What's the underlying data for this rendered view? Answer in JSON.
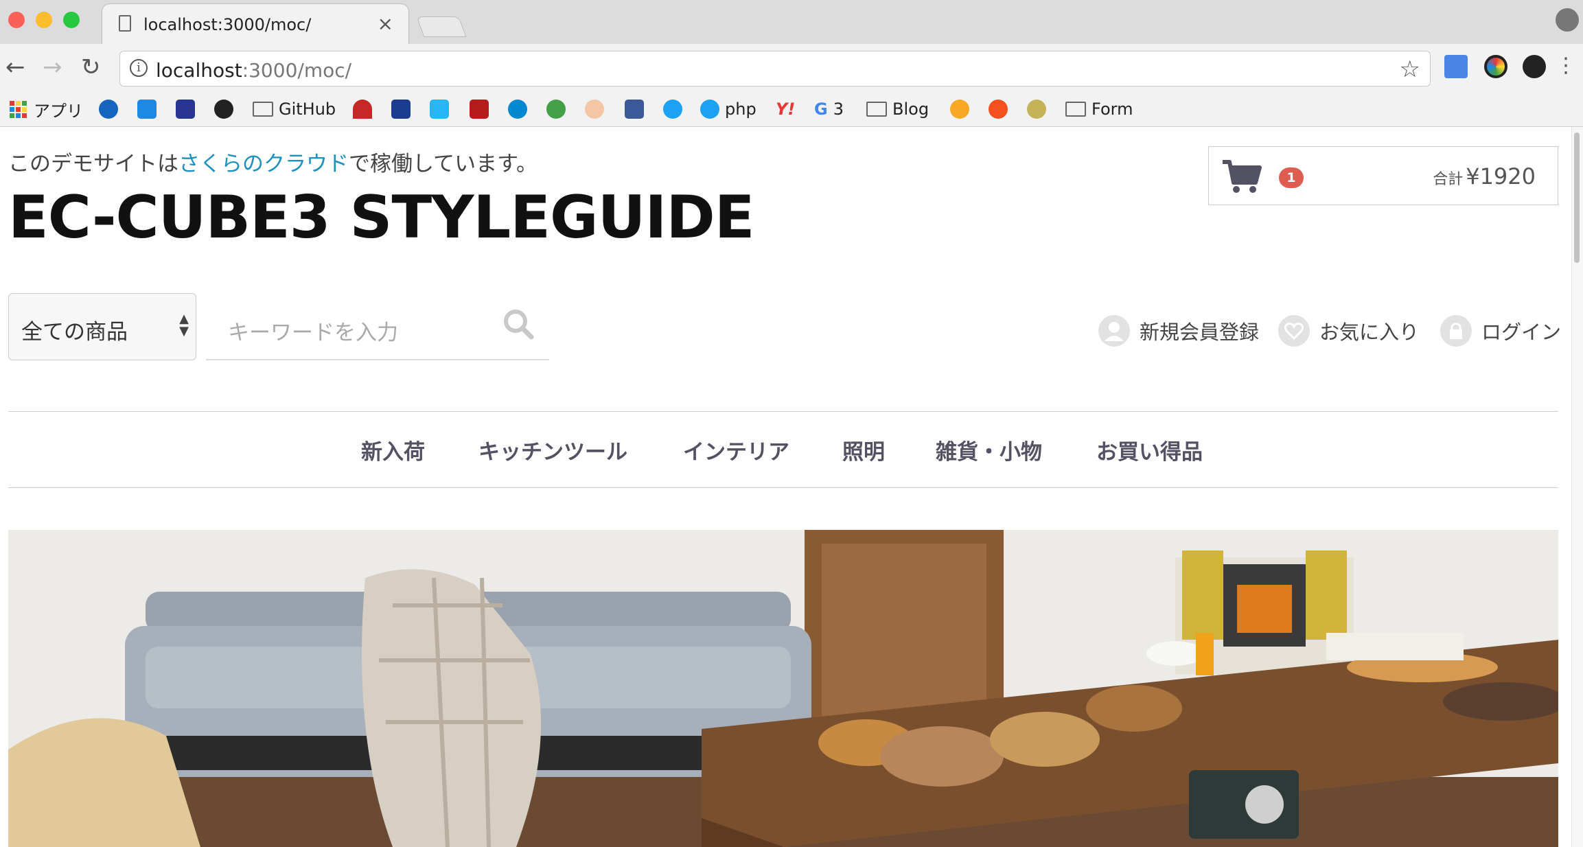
{
  "browser": {
    "tab_title": "localhost:3000/moc/",
    "url_host": "localhost",
    "url_rest": ":3000/moc/",
    "bookmarks": {
      "apps": "アプリ",
      "github": "GitHub",
      "php": "php",
      "g3": "3",
      "blog": "Blog",
      "form": "Form"
    }
  },
  "header": {
    "notice_prefix": "このデモサイトは",
    "notice_link": "さくらのクラウド",
    "notice_suffix": "で稼働しています。",
    "site_title": "EC-CUBE3 STYLEGUIDE"
  },
  "cart": {
    "count": "1",
    "total_label": "合計",
    "total_value": "¥1920"
  },
  "search": {
    "category": "全ての商品",
    "placeholder": "キーワードを入力"
  },
  "user_nav": {
    "register": "新規会員登録",
    "favorites": "お気に入り",
    "login": "ログイン"
  },
  "global_nav": [
    "新入荷",
    "キッチンツール",
    "インテリア",
    "照明",
    "雑貨・小物",
    "お買い得品"
  ],
  "colors": {
    "accent_link": "#1e90c0",
    "badge": "#de5d50",
    "nav_text": "#525263"
  }
}
